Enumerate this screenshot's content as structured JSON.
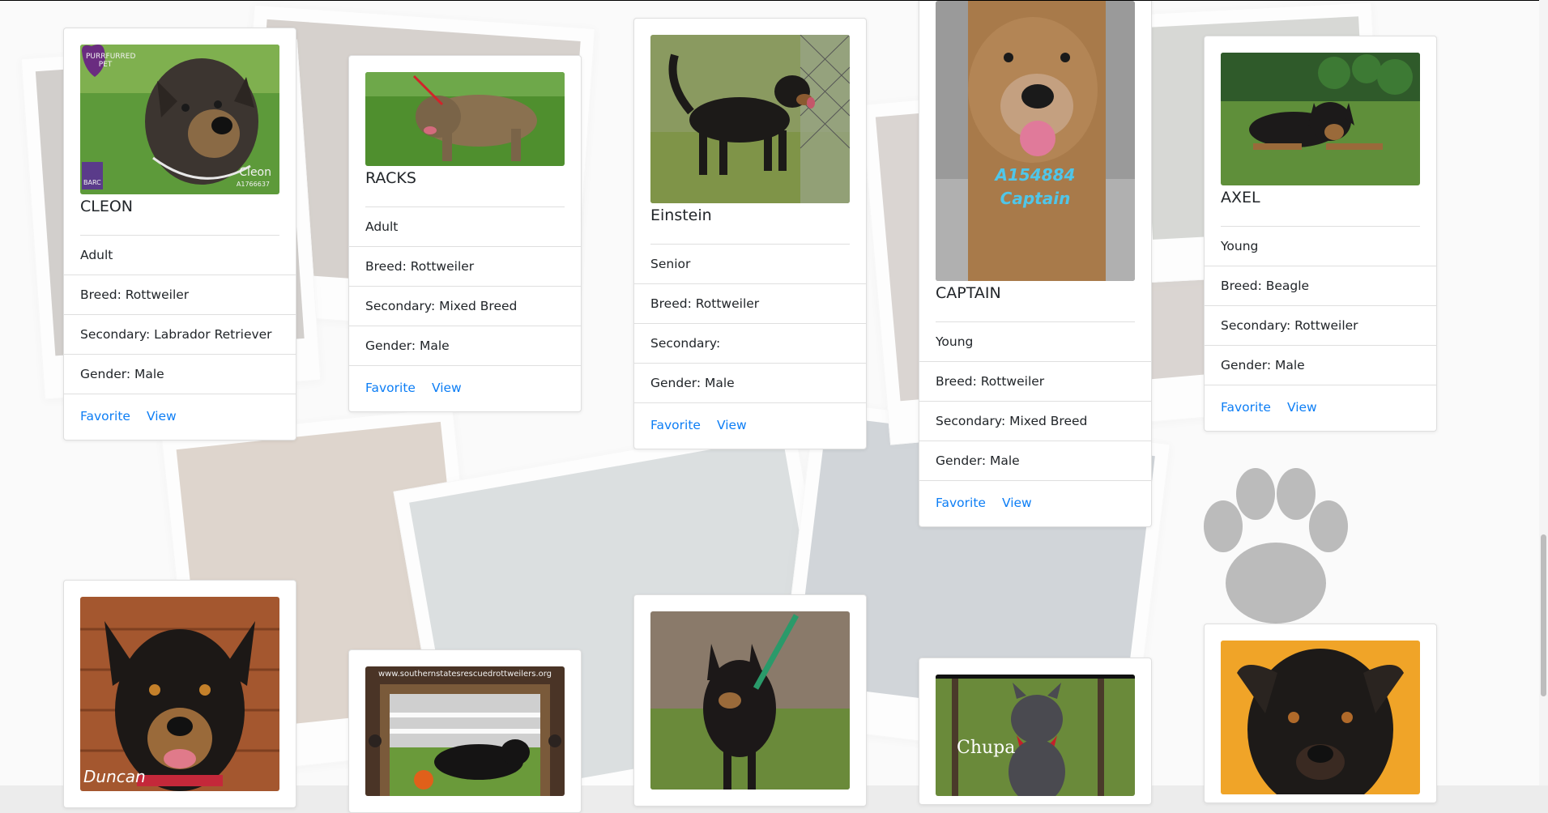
{
  "colors": {
    "link": "#0d7ef5",
    "border": "rgba(0,0,0,0.125)"
  },
  "background": {
    "icon": "paw-print-icon"
  },
  "pets": [
    {
      "name": "CLEON",
      "age": "Adult",
      "breed": "Breed: Rottweiler",
      "secondary": "Secondary: Labrador Retriever",
      "gender": "Gender: Male",
      "favorite": "Favorite",
      "view": "View",
      "photo_badge": "PURRFURRED PET",
      "photo_caption": "Cleon",
      "photo_id": "A1766637",
      "photo_logo": "BARC"
    },
    {
      "name": "RACKS",
      "age": "Adult",
      "breed": "Breed: Rottweiler",
      "secondary": "Secondary: Mixed Breed",
      "gender": "Gender: Male",
      "favorite": "Favorite",
      "view": "View"
    },
    {
      "name": "Einstein",
      "age": "Senior",
      "breed": "Breed: Rottweiler",
      "secondary": "Secondary:",
      "gender": "Gender: Male",
      "favorite": "Favorite",
      "view": "View"
    },
    {
      "name": "CAPTAIN",
      "age": "Young",
      "breed": "Breed: Rottweiler",
      "secondary": "Secondary: Mixed Breed",
      "gender": "Gender: Male",
      "favorite": "Favorite",
      "view": "View",
      "photo_id": "A154884",
      "photo_caption": "Captain"
    },
    {
      "name": "AXEL",
      "age": "Young",
      "breed": "Breed: Beagle",
      "secondary": "Secondary: Rottweiler",
      "gender": "Gender: Male",
      "favorite": "Favorite",
      "view": "View"
    },
    {
      "photo_caption": "Duncan"
    },
    {
      "photo_banner": "www.southernstatesrescuedrottweilers.org"
    },
    {},
    {
      "photo_caption": "Chupa"
    },
    {}
  ]
}
